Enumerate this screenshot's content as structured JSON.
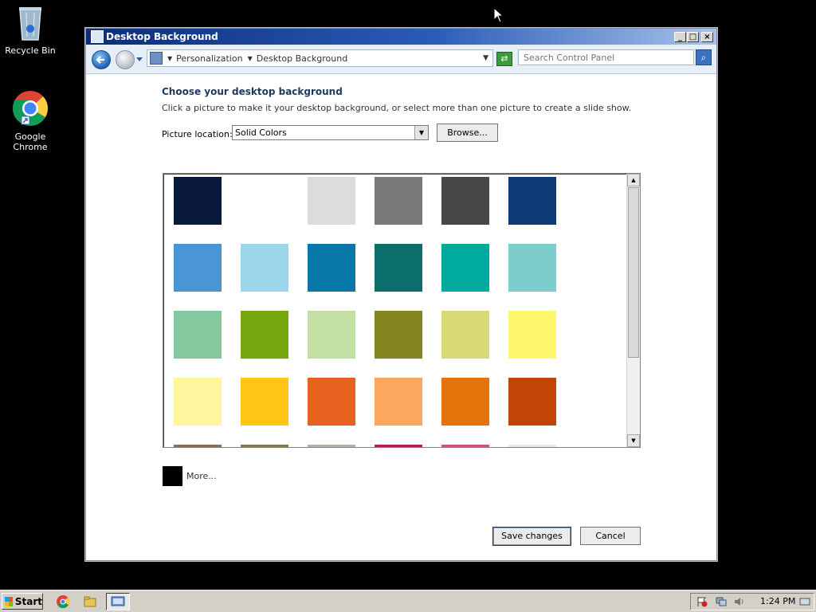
{
  "desktop": {
    "icons": [
      {
        "label": "Recycle Bin",
        "icon": "recycle-bin-icon"
      },
      {
        "label": "Google Chrome",
        "icon": "chrome-icon"
      }
    ]
  },
  "window": {
    "title": "Desktop Background",
    "controls": {
      "minimize": "_",
      "maximize": "□",
      "close": "×"
    }
  },
  "navbar": {
    "breadcrumb": [
      "Personalization",
      "Desktop Background"
    ],
    "search_placeholder": "Search Control Panel"
  },
  "content": {
    "heading": "Choose your desktop background",
    "description": "Click a picture to make it your desktop background, or select more than one picture to create a slide show.",
    "picture_location_label": "Picture location:",
    "picture_location_value": "Solid Colors",
    "browse_label": "Browse...",
    "swatches": [
      "#08183a",
      "#ffffff",
      "#dcdcdc",
      "#7a7a7a",
      "#474747",
      "#0c3a76",
      "#4a95d4",
      "#9cd6ea",
      "#0778a8",
      "#0c6d6d",
      "#00aa9c",
      "#7ccdcc",
      "#86c9a0",
      "#77a70f",
      "#c3e0a4",
      "#848620",
      "#d9da78",
      "#fdf56a",
      "#fff69e",
      "#fec514",
      "#e8621f",
      "#fba75d",
      "#e3740a",
      "#c24505",
      "#8a6b4c",
      "#857654",
      "#b7b0a0",
      "#b61b40",
      "#cf5278",
      "#ece4ec"
    ],
    "more_label": "More...",
    "more_color": "#000000",
    "save_label": "Save changes",
    "cancel_label": "Cancel"
  },
  "taskbar": {
    "start_label": "Start",
    "clock": "1:24 PM"
  }
}
